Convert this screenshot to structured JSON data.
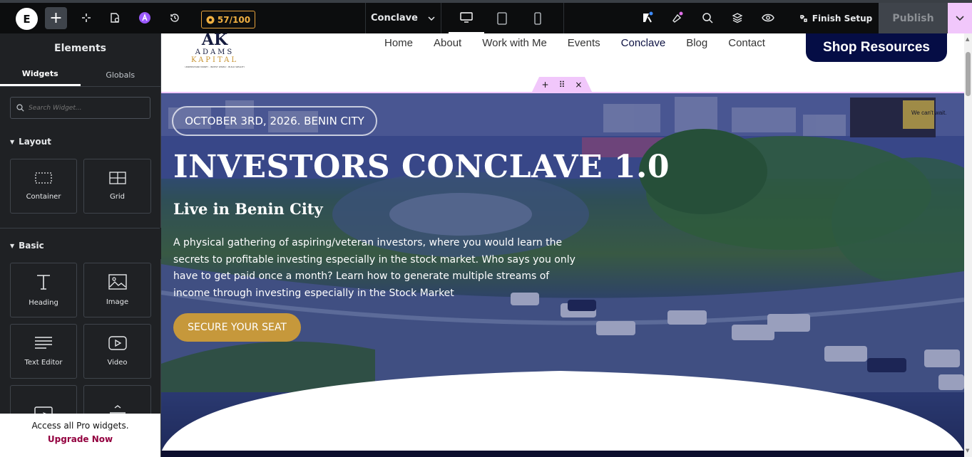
{
  "topbar": {
    "logo_letter": "E",
    "add_symbol": "+",
    "score": "57/100",
    "page_name": "Conclave",
    "finish_setup": "Finish Setup",
    "publish": "Publish",
    "accent": "#f1c7fb"
  },
  "sidebar": {
    "title": "Elements",
    "tabs": [
      "Widgets",
      "Globals"
    ],
    "search_placeholder": "Search Widget...",
    "sections": {
      "layout": {
        "label": "Layout",
        "widgets": [
          "Container",
          "Grid"
        ]
      },
      "basic": {
        "label": "Basic",
        "widgets": [
          "Heading",
          "Image",
          "Text Editor",
          "Video"
        ]
      }
    },
    "pro_text": "Access all Pro widgets.",
    "upgrade": "Upgrade Now"
  },
  "site": {
    "brand": {
      "mark": "AK",
      "line1": "ADAMS",
      "line2": "KAPITAL",
      "tagline": "UNDERSTAND MONEY . INVEST WISELY . BUILD WEALTH"
    },
    "nav": [
      "Home",
      "About",
      "Work with Me",
      "Events",
      "Conclave",
      "Blog",
      "Contact"
    ],
    "shop": "Shop Resources"
  },
  "hero": {
    "date": "OCTOBER 3RD, 2026. BENIN CITY",
    "title": "INVESTORS CONCLAVE 1.0",
    "subtitle": "Live in Benin City",
    "description": "A physical gathering of aspiring/veteran investors, where you would learn the secrets to profitable investing especially in the stock market. Who says you only have to get paid once a month? Learn how to generate multiple streams of income through investing especially in the Stock Market",
    "cta": "SECURE YOUR SEAT",
    "billboard": "We can't wait."
  }
}
